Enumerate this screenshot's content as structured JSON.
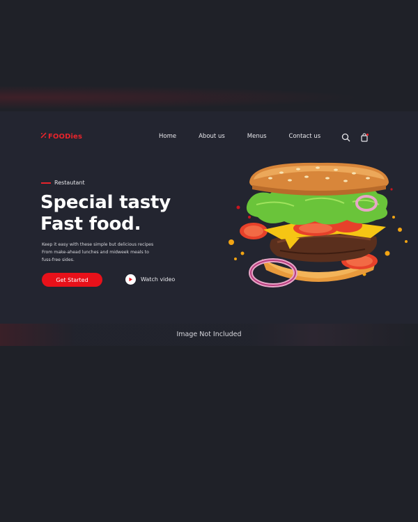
{
  "brand": {
    "name": "FOODies",
    "accent": "#e8242b"
  },
  "nav": {
    "items": [
      "Home",
      "About us",
      "Menus",
      "Contact us"
    ],
    "icons": [
      "search-icon",
      "shopping-bag-icon"
    ]
  },
  "hero": {
    "tagline": "Restautant",
    "headline_line1": "Special tasty",
    "headline_line2": "Fast food.",
    "description_line1": "Keep it easy with these simple but delicious recipes",
    "description_line2": "From make-ahead lunches and midweek meals to",
    "description_line3": "fuss-free sides.",
    "cta_label": "Get Started",
    "video_label": "Watch video"
  },
  "caption": "Image Not Included",
  "colors": {
    "background": "#1f2128",
    "hero_bg": "#232530",
    "button": "#e8111a"
  }
}
